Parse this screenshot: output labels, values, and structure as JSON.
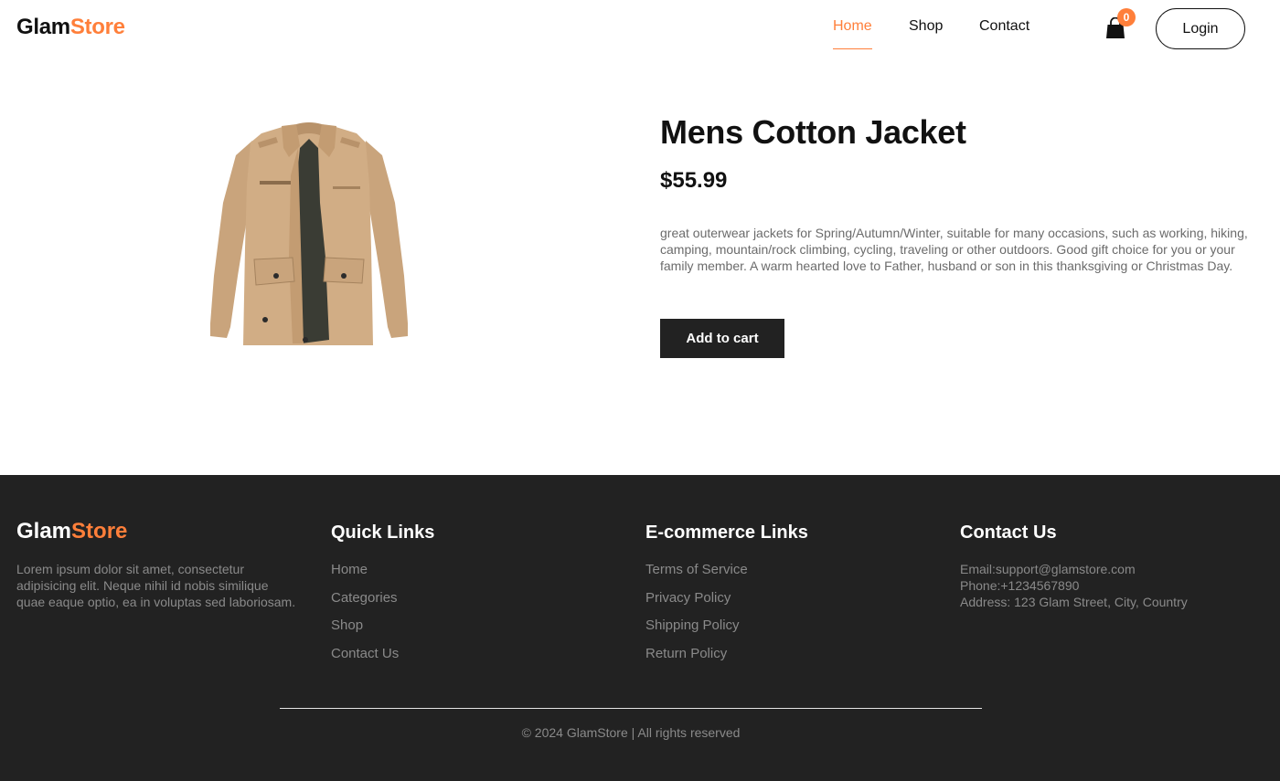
{
  "brand": {
    "part1": "Glam",
    "part2": "Store"
  },
  "nav": {
    "home": "Home",
    "shop": "Shop",
    "contact": "Contact",
    "cart_count": "0",
    "login": "Login"
  },
  "product": {
    "title": "Mens Cotton Jacket",
    "price": "$55.99",
    "description": "great outerwear jackets for Spring/Autumn/Winter, suitable for many occasions, such as working, hiking, camping, mountain/rock climbing, cycling, traveling or other outdoors. Good gift choice for you or your family member. A warm hearted love to Father, husband or son in this thanksgiving or Christmas Day.",
    "add_to_cart": "Add to cart"
  },
  "footer": {
    "about": "Lorem ipsum dolor sit amet, consectetur adipisicing elit. Neque nihil id nobis similique quae eaque optio, ea in voluptas sed laboriosam.",
    "quick_links": {
      "heading": "Quick Links",
      "items": [
        "Home",
        "Categories",
        "Shop",
        "Contact Us"
      ]
    },
    "ecommerce_links": {
      "heading": "E-commerce Links",
      "items": [
        "Terms of Service",
        "Privacy Policy",
        "Shipping Policy",
        "Return Policy"
      ]
    },
    "contact": {
      "heading": "Contact Us",
      "email": "Email:support@glamstore.com",
      "phone": "Phone:+1234567890",
      "address": "Address: 123 Glam Street, City, Country"
    },
    "copyright": "© 2024 GlamStore | All rights reserved"
  },
  "colors": {
    "accent": "#ff7f3a",
    "footer_bg": "#222222",
    "button_bg": "#222222"
  },
  "icons": {
    "cart": "shopping-bag-icon"
  }
}
